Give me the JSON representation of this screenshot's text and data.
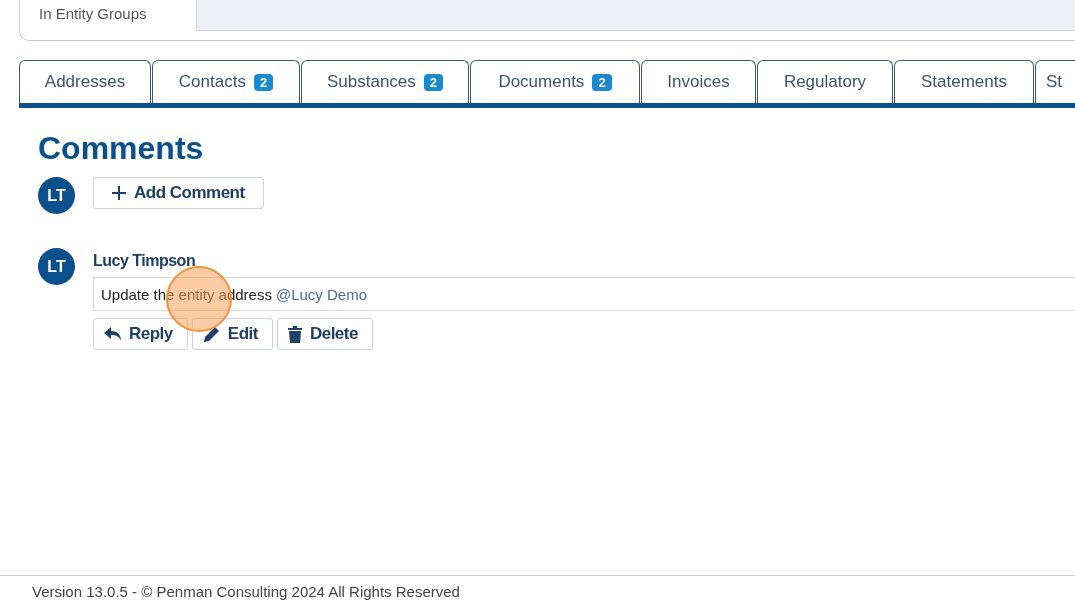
{
  "entity_groups": {
    "label": "In Entity Groups"
  },
  "tabs": [
    {
      "label": "Addresses",
      "selected": false
    },
    {
      "label": "Contacts",
      "badge": "2",
      "selected": false
    },
    {
      "label": "Substances",
      "badge": "2",
      "selected": false
    },
    {
      "label": "Documents",
      "badge": "2",
      "selected": false
    },
    {
      "label": "Invoices",
      "selected": false
    },
    {
      "label": "Regulatory",
      "selected": false
    },
    {
      "label": "Statements",
      "selected": false
    },
    {
      "label": "St",
      "selected": false
    }
  ],
  "comments": {
    "title": "Comments",
    "current_user_initials": "LT",
    "add_button": "Add Comment",
    "items": [
      {
        "initials": "LT",
        "author": "Lucy Timpson",
        "text": "Update the entity address",
        "mention": "@Lucy Demo",
        "actions": [
          {
            "kind": "reply",
            "label": "Reply"
          },
          {
            "kind": "edit",
            "label": "Edit"
          },
          {
            "kind": "delete",
            "label": "Delete"
          }
        ]
      }
    ]
  },
  "footer": "Version 13.0.5 - © Penman Consulting 2024 All Rights Reserved"
}
